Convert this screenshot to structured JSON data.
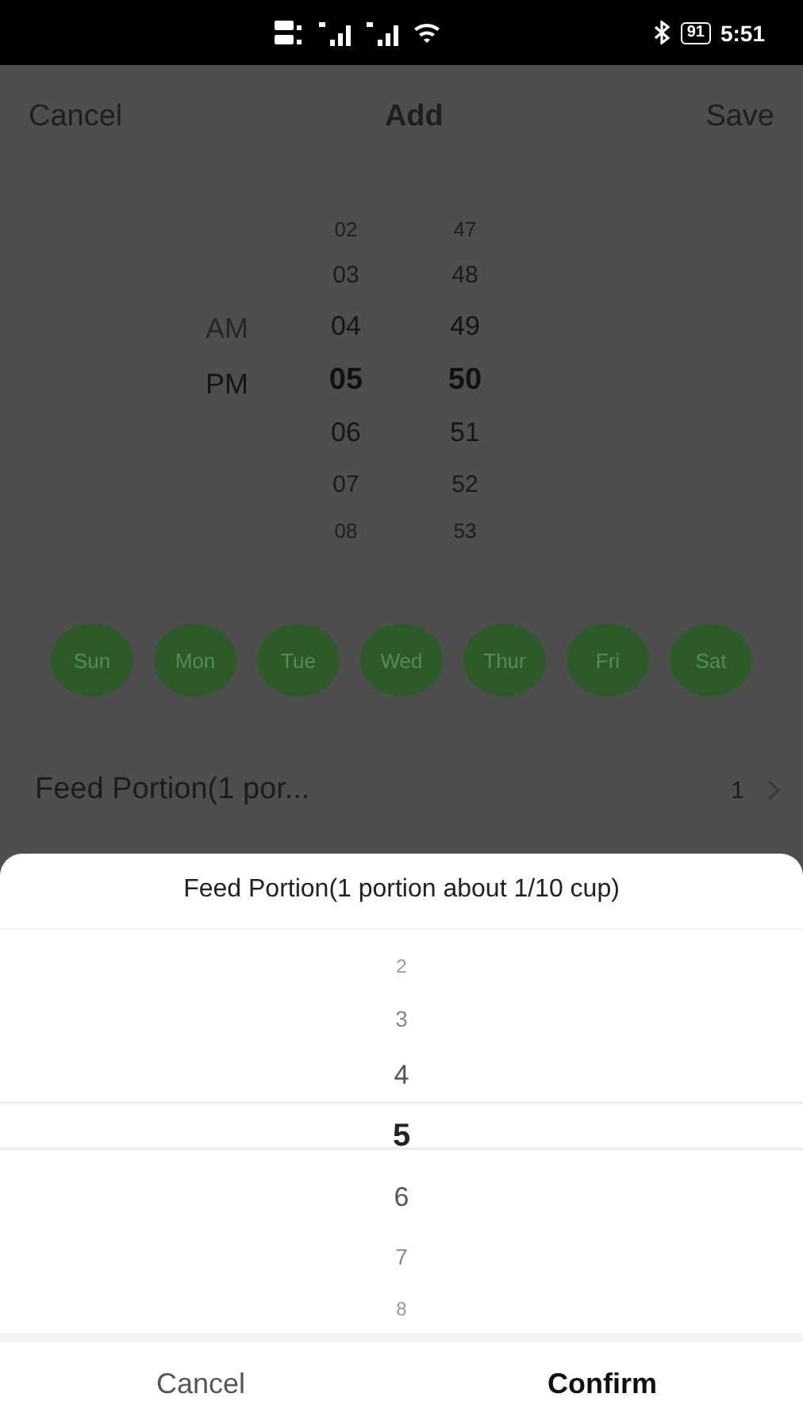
{
  "status_bar": {
    "battery": "91",
    "time": "5:51"
  },
  "header": {
    "cancel": "Cancel",
    "title": "Add",
    "save": "Save"
  },
  "time_picker": {
    "meridiem": [
      {
        "label": "AM",
        "selected": false
      },
      {
        "label": "PM",
        "selected": true
      }
    ],
    "hours": [
      {
        "label": "02",
        "selected": false
      },
      {
        "label": "03",
        "selected": false
      },
      {
        "label": "04",
        "selected": false
      },
      {
        "label": "05",
        "selected": true
      },
      {
        "label": "06",
        "selected": false
      },
      {
        "label": "07",
        "selected": false
      },
      {
        "label": "08",
        "selected": false
      }
    ],
    "minutes": [
      {
        "label": "47",
        "selected": false
      },
      {
        "label": "48",
        "selected": false
      },
      {
        "label": "49",
        "selected": false
      },
      {
        "label": "50",
        "selected": true
      },
      {
        "label": "51",
        "selected": false
      },
      {
        "label": "52",
        "selected": false
      },
      {
        "label": "53",
        "selected": false
      }
    ]
  },
  "days": [
    {
      "label": "Sun",
      "selected": true
    },
    {
      "label": "Mon",
      "selected": true
    },
    {
      "label": "Tue",
      "selected": true
    },
    {
      "label": "Wed",
      "selected": true
    },
    {
      "label": "Thur",
      "selected": true
    },
    {
      "label": "Fri",
      "selected": true
    },
    {
      "label": "Sat",
      "selected": true
    }
  ],
  "feed_row": {
    "label": "Feed Portion(1 por...",
    "value": "1"
  },
  "sheet": {
    "title": "Feed Portion(1 portion about 1/10 cup)",
    "options": [
      {
        "label": "2",
        "selected": false
      },
      {
        "label": "3",
        "selected": false
      },
      {
        "label": "4",
        "selected": false
      },
      {
        "label": "5",
        "selected": true
      },
      {
        "label": "6",
        "selected": false
      },
      {
        "label": "7",
        "selected": false
      },
      {
        "label": "8",
        "selected": false
      }
    ],
    "cancel": "Cancel",
    "confirm": "Confirm"
  }
}
